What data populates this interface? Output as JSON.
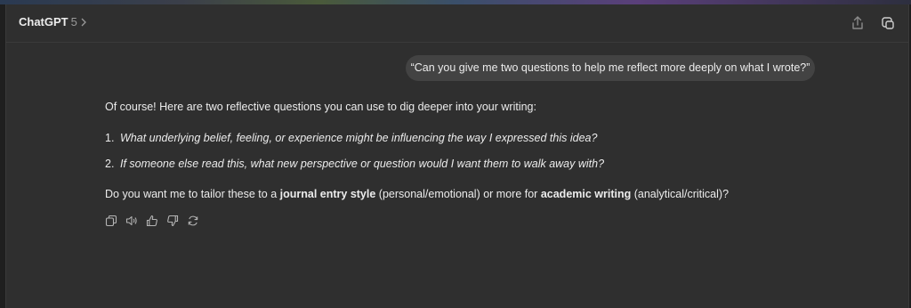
{
  "header": {
    "model_name": "ChatGPT",
    "model_version": "5",
    "share_icon": "share-icon",
    "new_window_icon": "new-chat-icon"
  },
  "user_message": "“Can you give me two questions to help me reflect more deeply on what I wrote?”",
  "assistant": {
    "intro": "Of course! Here are two reflective questions you can use to dig deeper into your writing:",
    "questions": [
      {
        "number": "1.",
        "text": "What underlying belief, feeling, or experience might be influencing the way I expressed this idea?"
      },
      {
        "number": "2.",
        "text": "If someone else read this, what new perspective or question would I want them to walk away with?"
      }
    ],
    "followup": {
      "part1": "Do you want me to tailor these to a ",
      "bold1": "journal entry style",
      "part2": " (personal/emotional) or more for ",
      "bold2": "academic writing",
      "part3": " (analytical/critical)?"
    }
  },
  "actions": [
    "copy-icon",
    "read-aloud-icon",
    "thumbs-up-icon",
    "thumbs-down-icon",
    "regenerate-icon"
  ],
  "colors": {
    "background": "#2f2f2f",
    "bubble": "#434343",
    "text": "#ececec",
    "muted": "#9a9a9a"
  }
}
